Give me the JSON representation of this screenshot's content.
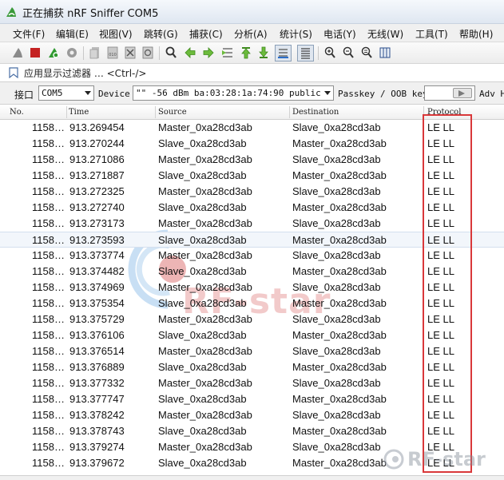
{
  "window": {
    "title": "正在捕获 nRF Sniffer COM5"
  },
  "menu": [
    {
      "label": "文件(F)"
    },
    {
      "label": "编辑(E)"
    },
    {
      "label": "视图(V)"
    },
    {
      "label": "跳转(G)"
    },
    {
      "label": "捕获(C)"
    },
    {
      "label": "分析(A)"
    },
    {
      "label": "统计(S)"
    },
    {
      "label": "电话(Y)"
    },
    {
      "label": "无线(W)"
    },
    {
      "label": "工具(T)"
    },
    {
      "label": "帮助(H)"
    }
  ],
  "toolbar_icons": [
    "shark-fin-icon",
    "stop-icon",
    "restart-icon",
    "capture-options-icon",
    "open-file-icon",
    "save-icon",
    "close-file-icon",
    "reload-icon",
    "find-icon",
    "back-icon",
    "forward-icon",
    "go-to-packet-icon",
    "first-packet-icon",
    "last-packet-icon",
    "autoscroll-icon",
    "colorize-icon",
    "zoom-in-icon",
    "zoom-out-icon",
    "normal-size-icon",
    "resize-columns-icon"
  ],
  "filter": {
    "text": "应用显示过滤器 … <Ctrl-/>"
  },
  "nrf": {
    "interface_label": "接口",
    "interface_value": "COM5",
    "device_label": "Device",
    "device_value": "\"\"  -56 dBm  ba:03:28:1a:74:90  public",
    "passkey_label": "Passkey / OOB key",
    "adv_label": "Adv H"
  },
  "columns": {
    "no": "No.",
    "time": "Time",
    "source": "Source",
    "destination": "Destination",
    "protocol": "Protocol"
  },
  "rows": [
    {
      "no": "1158…",
      "time": "913.269454",
      "src": "Master_0xa28cd3ab",
      "dst": "Slave_0xa28cd3ab",
      "proto": "LE LL"
    },
    {
      "no": "1158…",
      "time": "913.270244",
      "src": "Slave_0xa28cd3ab",
      "dst": "Master_0xa28cd3ab",
      "proto": "LE LL"
    },
    {
      "no": "1158…",
      "time": "913.271086",
      "src": "Master_0xa28cd3ab",
      "dst": "Slave_0xa28cd3ab",
      "proto": "LE LL"
    },
    {
      "no": "1158…",
      "time": "913.271887",
      "src": "Slave_0xa28cd3ab",
      "dst": "Master_0xa28cd3ab",
      "proto": "LE LL"
    },
    {
      "no": "1158…",
      "time": "913.272325",
      "src": "Master_0xa28cd3ab",
      "dst": "Slave_0xa28cd3ab",
      "proto": "LE LL"
    },
    {
      "no": "1158…",
      "time": "913.272740",
      "src": "Slave_0xa28cd3ab",
      "dst": "Master_0xa28cd3ab",
      "proto": "LE LL"
    },
    {
      "no": "1158…",
      "time": "913.273173",
      "src": "Master_0xa28cd3ab",
      "dst": "Slave_0xa28cd3ab",
      "proto": "LE LL"
    },
    {
      "no": "1158…",
      "time": "913.273593",
      "src": "Slave_0xa28cd3ab",
      "dst": "Master_0xa28cd3ab",
      "proto": "LE LL"
    },
    {
      "no": "1158…",
      "time": "913.373774",
      "src": "Master_0xa28cd3ab",
      "dst": "Slave_0xa28cd3ab",
      "proto": "LE LL"
    },
    {
      "no": "1158…",
      "time": "913.374482",
      "src": "Slave_0xa28cd3ab",
      "dst": "Master_0xa28cd3ab",
      "proto": "LE LL"
    },
    {
      "no": "1158…",
      "time": "913.374969",
      "src": "Master_0xa28cd3ab",
      "dst": "Slave_0xa28cd3ab",
      "proto": "LE LL"
    },
    {
      "no": "1158…",
      "time": "913.375354",
      "src": "Slave_0xa28cd3ab",
      "dst": "Master_0xa28cd3ab",
      "proto": "LE LL"
    },
    {
      "no": "1158…",
      "time": "913.375729",
      "src": "Master_0xa28cd3ab",
      "dst": "Slave_0xa28cd3ab",
      "proto": "LE LL"
    },
    {
      "no": "1158…",
      "time": "913.376106",
      "src": "Slave_0xa28cd3ab",
      "dst": "Master_0xa28cd3ab",
      "proto": "LE LL"
    },
    {
      "no": "1158…",
      "time": "913.376514",
      "src": "Master_0xa28cd3ab",
      "dst": "Slave_0xa28cd3ab",
      "proto": "LE LL"
    },
    {
      "no": "1158…",
      "time": "913.376889",
      "src": "Slave_0xa28cd3ab",
      "dst": "Master_0xa28cd3ab",
      "proto": "LE LL"
    },
    {
      "no": "1158…",
      "time": "913.377332",
      "src": "Master_0xa28cd3ab",
      "dst": "Slave_0xa28cd3ab",
      "proto": "LE LL"
    },
    {
      "no": "1158…",
      "time": "913.377747",
      "src": "Slave_0xa28cd3ab",
      "dst": "Master_0xa28cd3ab",
      "proto": "LE LL"
    },
    {
      "no": "1158…",
      "time": "913.378242",
      "src": "Master_0xa28cd3ab",
      "dst": "Slave_0xa28cd3ab",
      "proto": "LE LL"
    },
    {
      "no": "1158…",
      "time": "913.378743",
      "src": "Slave_0xa28cd3ab",
      "dst": "Master_0xa28cd3ab",
      "proto": "LE LL"
    },
    {
      "no": "1158…",
      "time": "913.379274",
      "src": "Master_0xa28cd3ab",
      "dst": "Slave_0xa28cd3ab",
      "proto": "LE LL"
    },
    {
      "no": "1158…",
      "time": "913.379672",
      "src": "Slave_0xa28cd3ab",
      "dst": "Master_0xa28cd3ab",
      "proto": "LE LL"
    }
  ],
  "selected_row": 7,
  "watermark": {
    "text": "RF-star",
    "color": "#cc2a2a"
  },
  "colors": {
    "accent": "#3b8bd8",
    "highlight_border": "#d9383a"
  }
}
